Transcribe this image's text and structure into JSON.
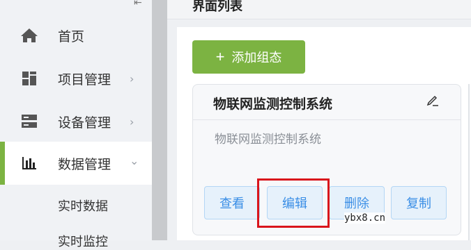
{
  "header": {
    "title": "界面列表"
  },
  "sidebar": {
    "collapse_icon": "collapse-arrow-icon",
    "items": [
      {
        "label": "首页",
        "icon": "home-icon"
      },
      {
        "label": "项目管理",
        "icon": "grid-icon",
        "chevron": "›"
      },
      {
        "label": "设备管理",
        "icon": "device-icon",
        "chevron": "›"
      },
      {
        "label": "数据管理",
        "icon": "bar-chart-icon",
        "chevron": "⌄",
        "active": true
      }
    ],
    "sub_items": [
      {
        "label": "实时数据"
      },
      {
        "label": "实时监控"
      }
    ]
  },
  "main": {
    "add_button": {
      "plus": "+",
      "label": "添加组态"
    },
    "card": {
      "name": "物联网监测控制系统",
      "description": "物联网监测控制系统",
      "actions": [
        {
          "label": "查看"
        },
        {
          "label": "编辑",
          "highlighted": true
        },
        {
          "label": "删除"
        },
        {
          "label": "复制"
        }
      ]
    }
  },
  "watermark": "ybx8.cn",
  "colors": {
    "accent": "#7cb342",
    "button_text": "#3a8ee6",
    "highlight": "#d9141b"
  }
}
